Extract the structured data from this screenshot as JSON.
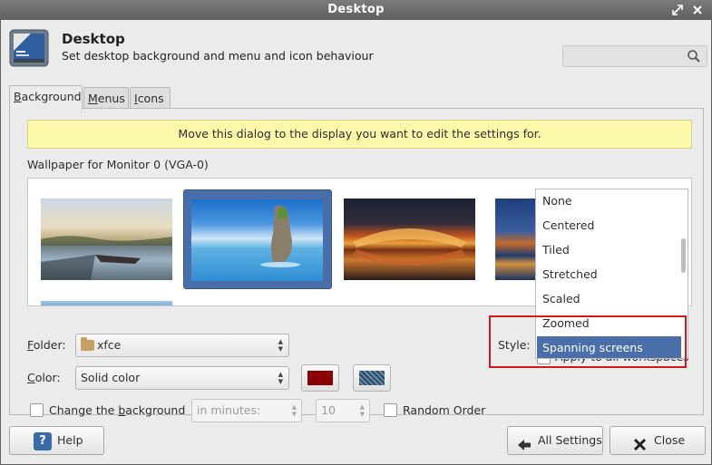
{
  "window": {
    "title": "Desktop"
  },
  "header": {
    "title": "Desktop",
    "subtitle": "Set desktop background and menu and icon behaviour",
    "search_placeholder": ""
  },
  "tabs": [
    {
      "label": "Background",
      "mnemonic": "B",
      "rest": "ackground",
      "active": true
    },
    {
      "label": "Menus",
      "mnemonic": "M",
      "rest": "enus",
      "active": false
    },
    {
      "label": "Icons",
      "mnemonic": "I",
      "rest": "cons",
      "active": false
    }
  ],
  "background": {
    "info_message": "Move this dialog to the display you want to edit the settings for.",
    "wallpaper_label": "Wallpaper for Monitor 0 (VGA-0)",
    "folder": {
      "label_mnemonic": "F",
      "label_rest": "older:",
      "value": "xfce"
    },
    "style": {
      "label": "Style:"
    },
    "color": {
      "label_mnemonic": "C",
      "label_rest": "olor:",
      "value": "Solid color",
      "primary": "#8b0000",
      "secondary": "#3a5a78"
    },
    "change_background": {
      "label_before": "Change the ",
      "label_mnemonic": "b",
      "label_after": "ackground",
      "checked": false
    },
    "interval": {
      "unit": "in minutes:",
      "value": "10"
    },
    "random_order": {
      "label": "Random Order",
      "checked": false
    },
    "apply_all": {
      "label": "Apply to all workspaces"
    }
  },
  "style_options": [
    "None",
    "Centered",
    "Tiled",
    "Stretched",
    "Scaled",
    "Zoomed",
    "Spanning screens"
  ],
  "style_selected": "Spanning screens",
  "footer": {
    "help": "Help",
    "all_settings": "All Settings",
    "close": "Close"
  },
  "colors": {
    "selection": "#4a6ea9",
    "highlight_box": "#d11a1a",
    "info_bg": "#fcf8a9"
  }
}
